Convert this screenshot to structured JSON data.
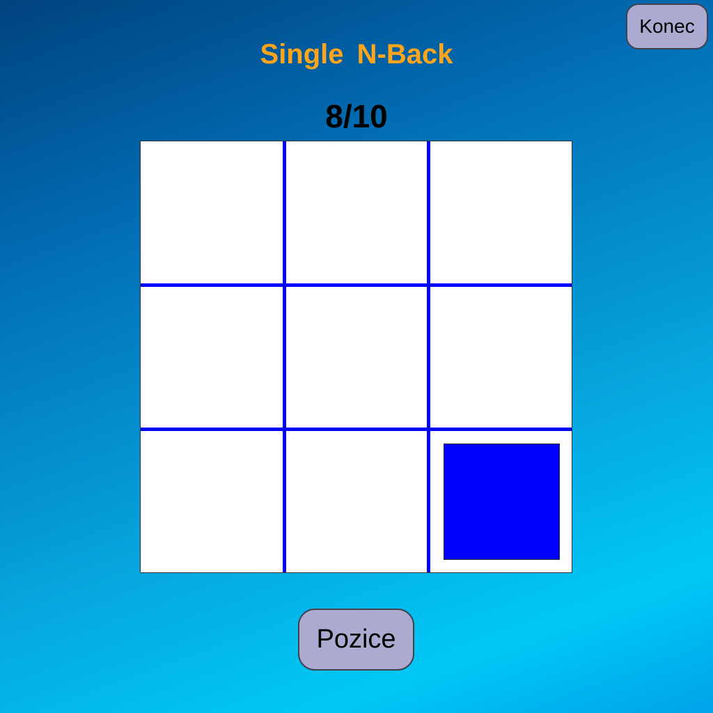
{
  "header": {
    "title": "Single  N-Back",
    "end_label": "Konec"
  },
  "progress": {
    "text": "8/10",
    "current": 8,
    "total": 10
  },
  "grid": {
    "rows": 3,
    "cols": 3,
    "active_cell": {
      "row": 3,
      "col": 3
    },
    "line_color": "#0000ff",
    "square_color": "#0000ff",
    "cell_color": "#ffffff"
  },
  "controls": {
    "position_label": "Pozice"
  },
  "colors": {
    "title": "#ffa41b",
    "button_bg": "#abaad0"
  }
}
